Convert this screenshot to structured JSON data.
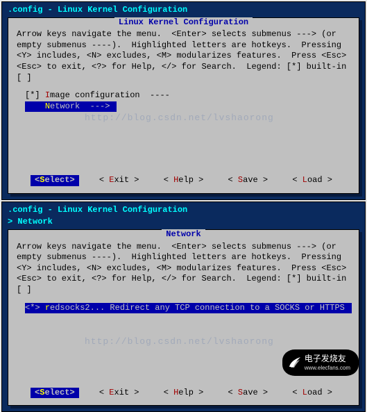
{
  "windows": [
    {
      "title": ".config - Linux Kernel Configuration",
      "breadcrumb": null,
      "dialog_title": "Linux Kernel Configuration",
      "help": "Arrow keys navigate the menu.  <Enter> selects submenus ---> (or empty submenus ----).  Highlighted letters are hotkeys.  Pressing <Y> includes, <N> excludes, <M> modularizes features.  Press <Esc><Esc> to exit, <?> for Help, </> for Search.  Legend: [*] built-in  [ ]",
      "items": [
        {
          "marker": "[*]",
          "hot": "I",
          "rest": "mage configuration  ----",
          "selected": false
        },
        {
          "marker": "   ",
          "hot": "N",
          "rest": "etwork  --->",
          "selected": true
        }
      ],
      "watermark": "http://blog.csdn.net/lvshaorong"
    },
    {
      "title": ".config - Linux Kernel Configuration",
      "breadcrumb": "> Network",
      "dialog_title": "Network",
      "help": "Arrow keys navigate the menu.  <Enter> selects submenus ---> (or empty submenus ----).  Highlighted letters are hotkeys.  Pressing <Y> includes, <N> excludes, <M> modularizes features.  Press <Esc><Esc> to exit, <?> for Help, </> for Search.  Legend: [*] built-in  [ ]",
      "items": [
        {
          "marker": "<*>",
          "hot": "r",
          "rest": "edsocks2... Redirect any TCP connection to a SOCKS or HTTPS",
          "selected": true
        }
      ],
      "watermark": "http://blog.csdn.net/lvshaorong"
    }
  ],
  "buttons": [
    {
      "hot": "S",
      "rest": "elect",
      "selected": true
    },
    {
      "hot": "E",
      "rest": "xit",
      "selected": false
    },
    {
      "hot": "H",
      "rest": "elp",
      "selected": false
    },
    {
      "hot": "S",
      "rest": "ave",
      "selected": false
    },
    {
      "hot": "L",
      "rest": "oad",
      "selected": false
    }
  ],
  "logo": {
    "main": "电子发烧友",
    "sub": "www.elecfans.com"
  }
}
